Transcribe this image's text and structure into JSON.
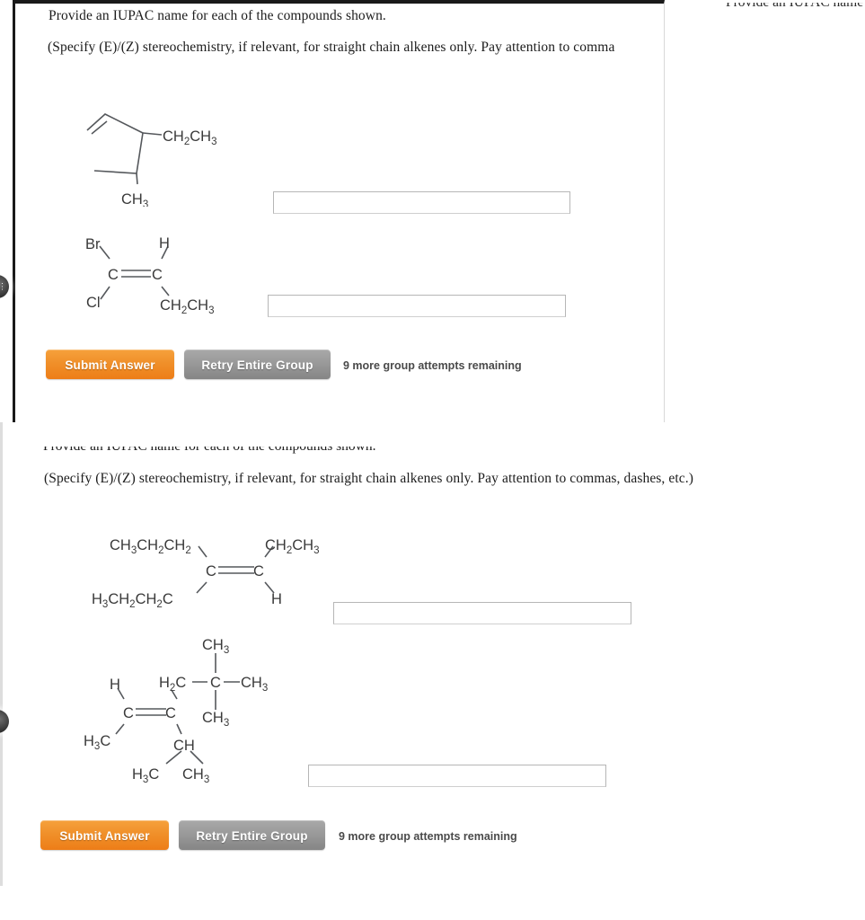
{
  "page": {
    "background": "#ffffff",
    "accent_orange": "#f0902a",
    "accent_gray": "#9a9a9a"
  },
  "ghost_heading_right": "Provide an IUPAC name f",
  "question_groups": [
    {
      "id": "group-1",
      "heading": "Provide an IUPAC name for each of the compounds shown.",
      "instruction": "(Specify (E)/(Z) stereochemistry, if relevant, for straight chain alkenes only. Pay attention to comma",
      "compounds": [
        {
          "id": "compound-1",
          "description": "cyclopentene ring with ethyl and methyl substituents",
          "labels": {
            "ethyl": "CH2CH3",
            "ethyl_parts": [
              "CH",
              "2",
              "CH",
              "3"
            ],
            "methyl_parts": [
              "CH",
              "3"
            ]
          },
          "answer_value": "",
          "answer_placeholder": ""
        },
        {
          "id": "compound-2",
          "description": "1-bromo-1-chloro alkene with ethyl group",
          "labels": {
            "br": "Br",
            "cl": "Cl",
            "h": "H",
            "c_left": "C",
            "c_right": "C",
            "ethyl_parts": [
              "CH",
              "2",
              "CH",
              "3"
            ]
          },
          "answer_value": "",
          "answer_placeholder": ""
        }
      ],
      "submit_label": "Submit Answer",
      "retry_label": "Retry Entire Group",
      "attempts_text": "9 more group attempts remaining"
    },
    {
      "id": "group-2",
      "heading": "Provide an IUPAC name for each of the compounds shown.",
      "instruction": "(Specify (E)/(Z) stereochemistry, if relevant, for straight chain alkenes only. Pay attention to commas, dashes, etc.)",
      "compounds": [
        {
          "id": "compound-3",
          "description": "tetra-substituted alkene with two propyl groups, ethyl and hydrogen",
          "labels": {
            "upper_left_parts": [
              "CH",
              "3",
              "CH",
              "2",
              "CH",
              "2"
            ],
            "upper_right_parts": [
              "CH",
              "2",
              "CH",
              "3"
            ],
            "lower_left_parts": [
              "H",
              "3",
              "CH",
              "2",
              "CH",
              "2",
              "C"
            ],
            "lower_right_h": "H",
            "c_left": "C",
            "c_right": "C"
          },
          "answer_value": "",
          "answer_placeholder": ""
        },
        {
          "id": "compound-4",
          "description": "alkene bearing a neopentyl (CH2-C(CH3)3) group and an isopropyl group",
          "labels": {
            "h_top": "H",
            "ch3_left_parts": [
              "H",
              "3",
              "C"
            ],
            "c_left": "C",
            "c_right": "C",
            "ch2_parts": [
              "H",
              "2",
              "C"
            ],
            "quaternary_c": "C",
            "ch3_top_parts": [
              "CH",
              "3"
            ],
            "ch3_right_parts": [
              "CH",
              "3"
            ],
            "ch3_bottom_parts": [
              "CH",
              "3"
            ],
            "ch_parts": [
              "CH"
            ],
            "iso_left_parts": [
              "H",
              "3",
              "C"
            ],
            "iso_right_parts": [
              "CH",
              "3"
            ]
          },
          "answer_value": "",
          "answer_placeholder": ""
        }
      ],
      "submit_label": "Submit Answer",
      "retry_label": "Retry Entire Group",
      "attempts_text": "9 more group attempts remaining"
    }
  ],
  "nav_handles": [
    {
      "id": "nav-handle-upper",
      "glyph": "⋮"
    },
    {
      "id": "nav-handle-lower",
      "glyph": ""
    }
  ]
}
